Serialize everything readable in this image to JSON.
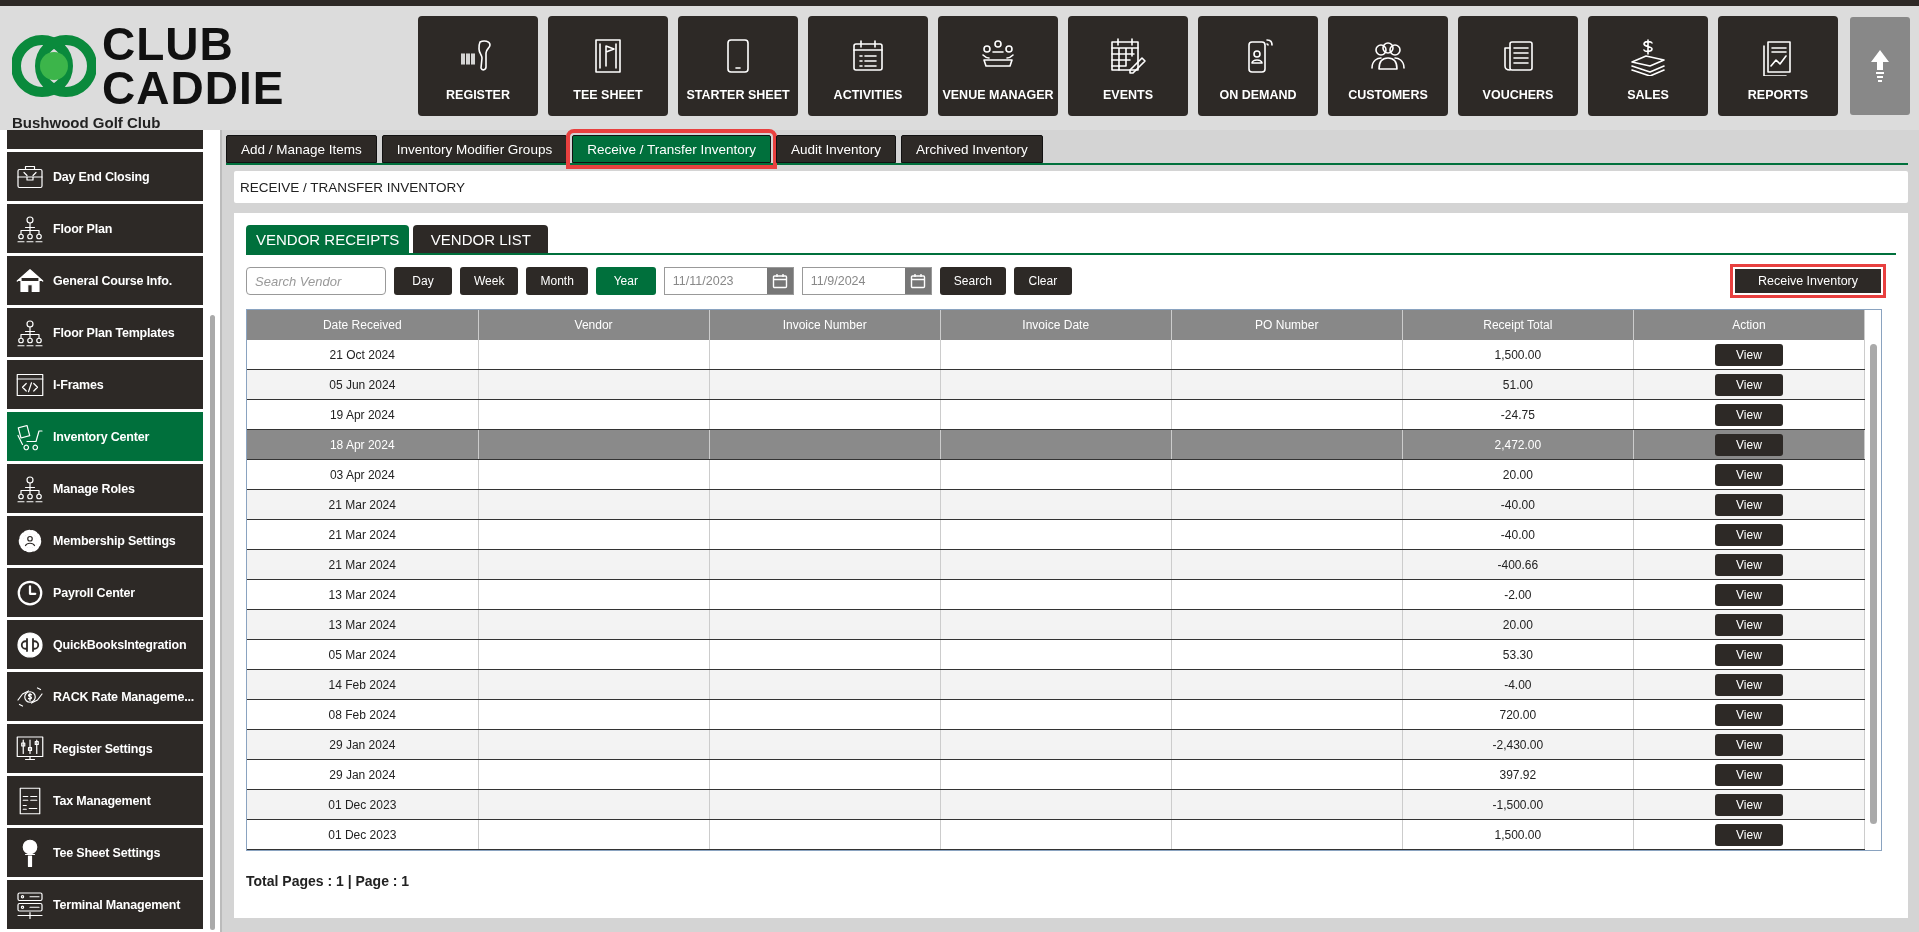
{
  "logo": {
    "line1": "CLUB",
    "line2": "CADDIE",
    "club_name": "Bushwood Golf Club"
  },
  "nav": [
    {
      "label": "REGISTER"
    },
    {
      "label": "TEE SHEET"
    },
    {
      "label": "STARTER SHEET"
    },
    {
      "label": "ACTIVITIES"
    },
    {
      "label": "VENUE MANAGER"
    },
    {
      "label": "EVENTS"
    },
    {
      "label": "ON DEMAND"
    },
    {
      "label": "CUSTOMERS"
    },
    {
      "label": "VOUCHERS"
    },
    {
      "label": "SALES"
    },
    {
      "label": "REPORTS"
    }
  ],
  "sidebar": {
    "items": [
      {
        "label": "Day End Closing",
        "selected": false
      },
      {
        "label": "Floor Plan",
        "selected": false
      },
      {
        "label": "General Course Info.",
        "selected": false
      },
      {
        "label": "Floor Plan Templates",
        "selected": false
      },
      {
        "label": "I-Frames",
        "selected": false
      },
      {
        "label": "Inventory Center",
        "selected": true
      },
      {
        "label": "Manage Roles",
        "selected": false
      },
      {
        "label": "Membership Settings",
        "selected": false
      },
      {
        "label": "Payroll Center",
        "selected": false
      },
      {
        "label": "QuickBooksIntegration",
        "selected": false
      },
      {
        "label": "RACK Rate Manageme...",
        "selected": false
      },
      {
        "label": "Register Settings",
        "selected": false
      },
      {
        "label": "Tax Management",
        "selected": false
      },
      {
        "label": "Tee Sheet Settings",
        "selected": false
      },
      {
        "label": "Terminal Management",
        "selected": false
      }
    ]
  },
  "tabs": [
    {
      "label": "Add / Manage Items",
      "selected": false,
      "highlighted": false
    },
    {
      "label": "Inventory Modifier Groups",
      "selected": false,
      "highlighted": false
    },
    {
      "label": "Receive / Transfer Inventory",
      "selected": true,
      "highlighted": true
    },
    {
      "label": "Audit Inventory",
      "selected": false,
      "highlighted": false
    },
    {
      "label": "Archived Inventory",
      "selected": false,
      "highlighted": false
    }
  ],
  "page_title": "RECEIVE / TRANSFER INVENTORY",
  "sub_tabs": [
    {
      "label": "VENDOR RECEIPTS",
      "selected": true
    },
    {
      "label": "VENDOR LIST",
      "selected": false
    }
  ],
  "filters": {
    "search": {
      "placeholder": "Search Vendor"
    },
    "periods": [
      {
        "label": "Day",
        "selected": false
      },
      {
        "label": "Week",
        "selected": false
      },
      {
        "label": "Month",
        "selected": false
      },
      {
        "label": "Year",
        "selected": true
      }
    ],
    "start_date": "11/11/2023",
    "end_date": "11/9/2024",
    "buttons": [
      "Search",
      "Clear"
    ]
  },
  "receive_button": {
    "label": "Receive Inventory",
    "highlighted": true
  },
  "table": {
    "columns": [
      "Date Received",
      "Vendor",
      "Invoice Number",
      "Invoice Date",
      "PO Number",
      "Receipt Total",
      "Action"
    ],
    "rows": [
      {
        "date_received": "21 Oct 2024",
        "receipt_total": "1,500.00",
        "action": "View",
        "selected": false
      },
      {
        "date_received": "05 Jun 2024",
        "receipt_total": "51.00",
        "action": "View",
        "selected": false
      },
      {
        "date_received": "19 Apr 2024",
        "receipt_total": "-24.75",
        "action": "View",
        "selected": false
      },
      {
        "date_received": "18 Apr 2024",
        "receipt_total": "2,472.00",
        "action": "View",
        "selected": true
      },
      {
        "date_received": "03 Apr 2024",
        "receipt_total": "20.00",
        "action": "View",
        "selected": false
      },
      {
        "date_received": "21 Mar 2024",
        "receipt_total": "-40.00",
        "action": "View",
        "selected": false
      },
      {
        "date_received": "21 Mar 2024",
        "receipt_total": "-40.00",
        "action": "View",
        "selected": false
      },
      {
        "date_received": "21 Mar 2024",
        "receipt_total": "-400.66",
        "action": "View",
        "selected": false
      },
      {
        "date_received": "13 Mar 2024",
        "receipt_total": "-2.00",
        "action": "View",
        "selected": false
      },
      {
        "date_received": "13 Mar 2024",
        "receipt_total": "20.00",
        "action": "View",
        "selected": false
      },
      {
        "date_received": "05 Mar 2024",
        "receipt_total": "53.30",
        "action": "View",
        "selected": false
      },
      {
        "date_received": "14 Feb 2024",
        "receipt_total": "-4.00",
        "action": "View",
        "selected": false
      },
      {
        "date_received": "08 Feb 2024",
        "receipt_total": "720.00",
        "action": "View",
        "selected": false
      },
      {
        "date_received": "29 Jan 2024",
        "receipt_total": "-2,430.00",
        "action": "View",
        "selected": false
      },
      {
        "date_received": "29 Jan 2024",
        "receipt_total": "397.92",
        "action": "View",
        "selected": false
      },
      {
        "date_received": "01 Dec 2023",
        "receipt_total": "-1,500.00",
        "action": "View",
        "selected": false
      },
      {
        "date_received": "01 Dec 2023",
        "receipt_total": "1,500.00",
        "action": "View",
        "selected": false
      }
    ]
  },
  "footer": "Total Pages : 1 | Page : 1"
}
